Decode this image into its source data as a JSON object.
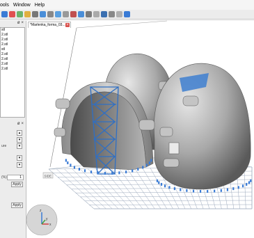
{
  "menu": {
    "items": [
      "ools",
      "Window",
      "Help"
    ]
  },
  "toolbar": {
    "colors": [
      "#3a7bd5",
      "#e05050",
      "#6bb36b",
      "#e0b040",
      "#777",
      "#4a8ed8",
      "#888",
      "#5aa0e0",
      "#999",
      "#c05050",
      "#4a8ed8",
      "#7a7a7a",
      "#aaa",
      "#3a6fb0",
      "#888",
      "#b0b0b0",
      "#3a7bd5"
    ]
  },
  "tabs": [
    {
      "label": "*Marlenka_forma_03...",
      "close": "×"
    }
  ],
  "files": [
    "stl",
    "2.stl",
    "2.stl",
    "2.stl",
    "stl",
    "2.stl",
    "2.stl",
    "2.stl",
    "2.stl"
  ],
  "panel": {
    "header_pin": "ø",
    "header_close": "×",
    "ure_label": "ure",
    "field_label": "(%)",
    "field_value": "1",
    "apply_1": "Apply",
    "apply_2": "Apply"
  },
  "viewport": {
    "side_badge": "SIDE",
    "axis_x": "x",
    "axis_y": "y",
    "axis_z": "z"
  }
}
